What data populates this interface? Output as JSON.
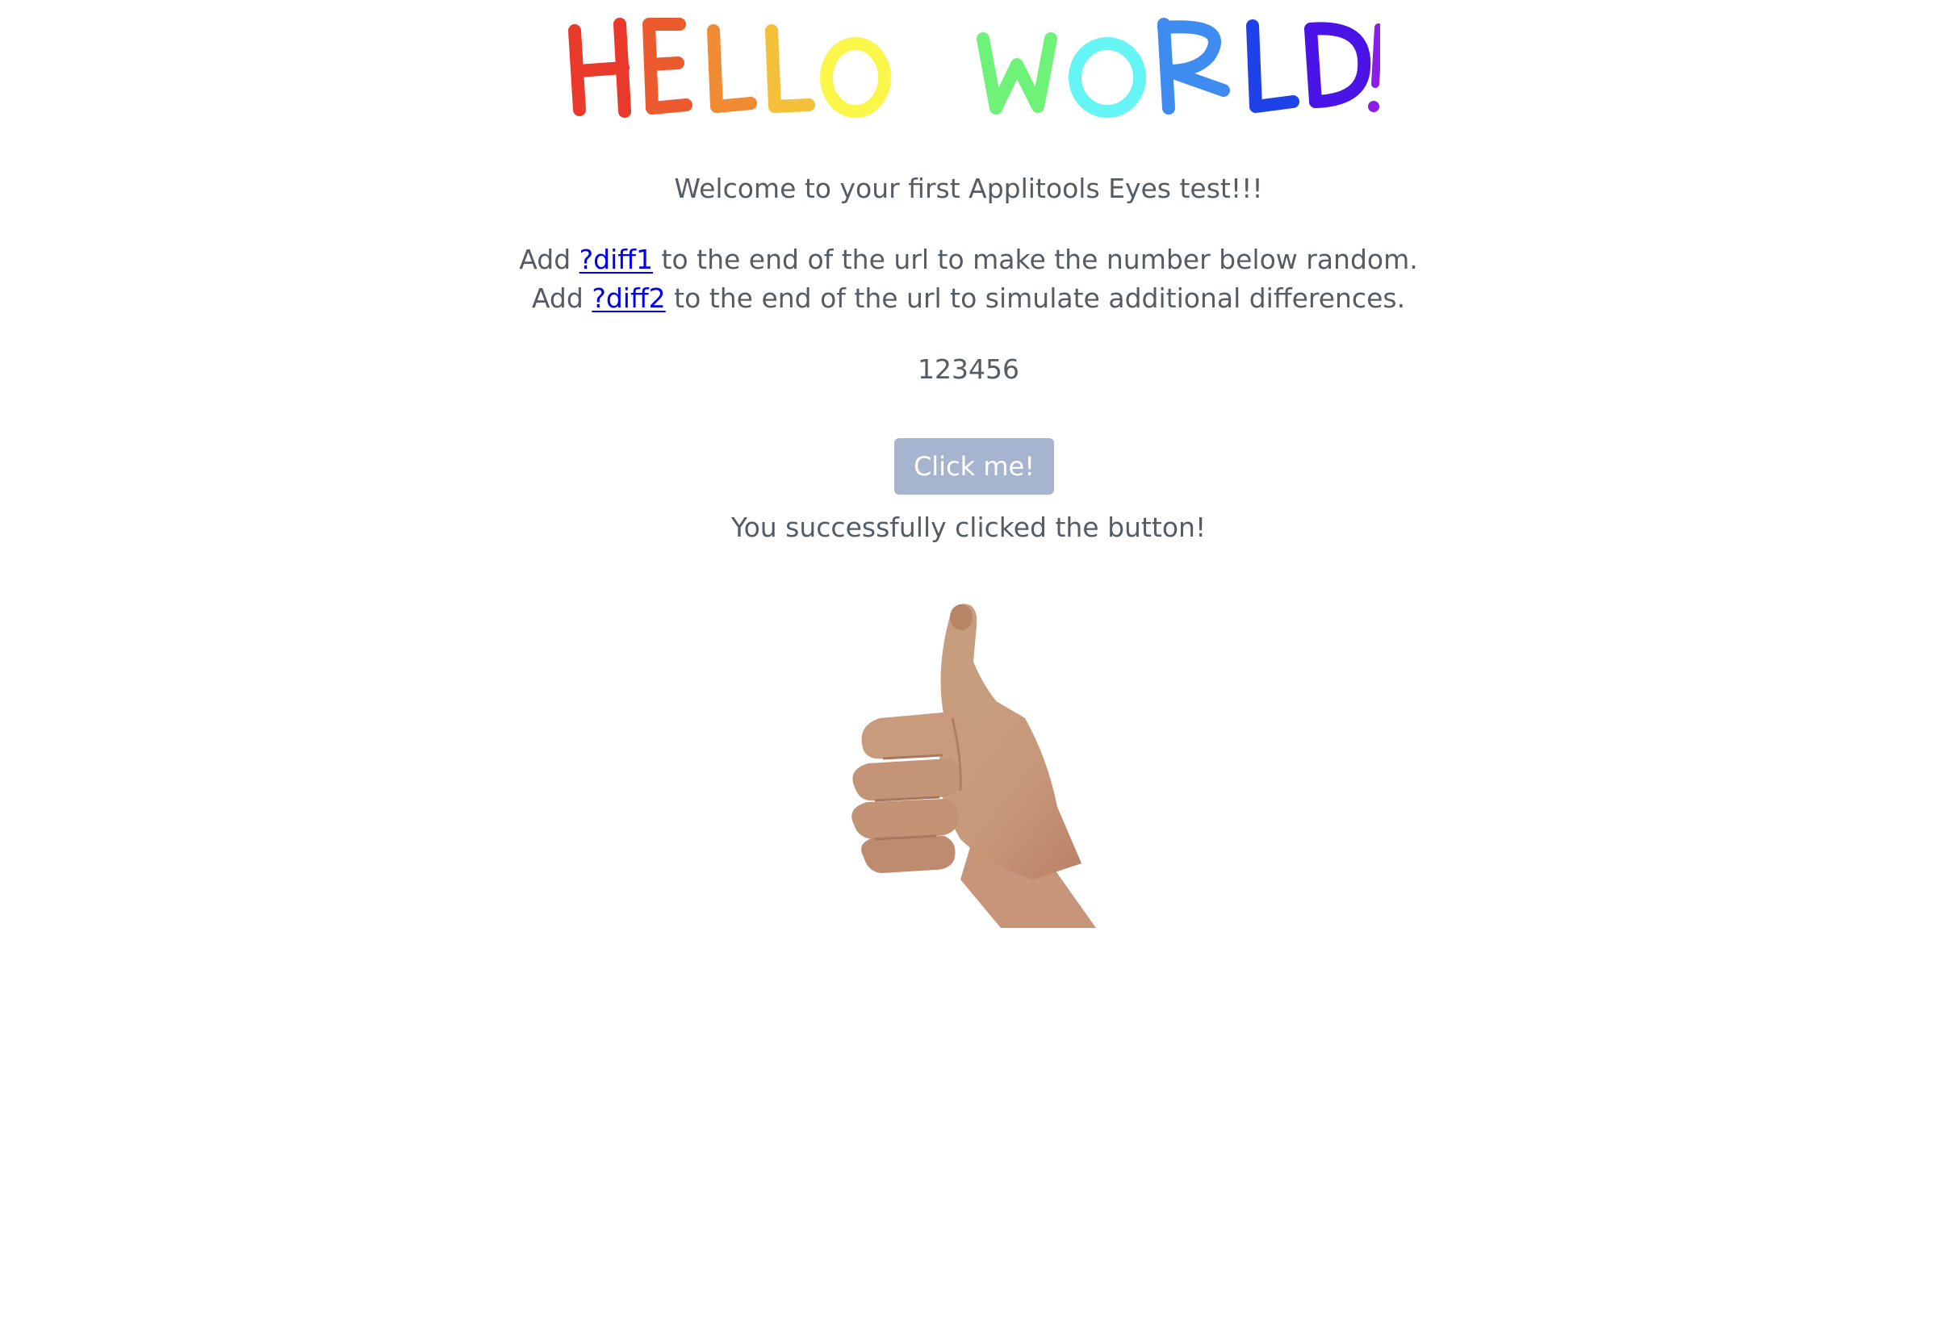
{
  "banner": {
    "letters": [
      "H",
      "E",
      "L",
      "L",
      "O",
      " ",
      "W",
      "O",
      "R",
      "L",
      "D",
      "!"
    ],
    "colors": [
      "#e8392a",
      "#ec5b2e",
      "#f08a33",
      "#f4c03a",
      "#fbf64a",
      "",
      "#6ef277",
      "#66f5f5",
      "#3f8cf0",
      "#1e42e8",
      "#4b14e6",
      "#8a1de6"
    ]
  },
  "intro": {
    "welcome": "Welcome to your first Applitools Eyes test!!!",
    "line1_prefix": "Add ",
    "line1_link": "?diff1",
    "line1_suffix": " to the end of the url to make the number below random.",
    "line2_prefix": "Add ",
    "line2_link": "?diff2",
    "line2_suffix": " to the end of the url to simulate additional differences."
  },
  "number_value": "123456",
  "button": {
    "label": "Click me!"
  },
  "success_message": "You successfully clicked the button!",
  "image": {
    "icon": "thumbs-up-hand"
  },
  "colors": {
    "text": "#555c63",
    "link": "#0000ee",
    "button_bg": "#a6b4cf",
    "button_text": "#ffffff"
  }
}
